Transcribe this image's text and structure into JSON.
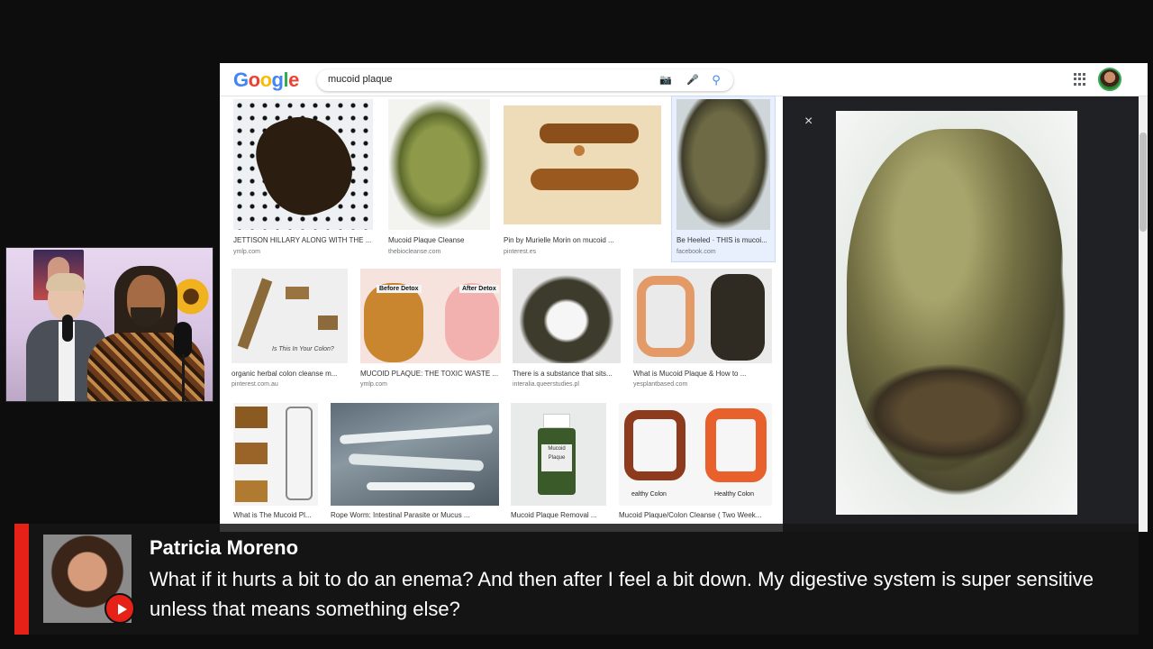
{
  "search": {
    "query": "mucoid plaque"
  },
  "logo": {
    "letters": [
      "G",
      "o",
      "o",
      "g",
      "l",
      "e"
    ]
  },
  "results": [
    {
      "caption": "JETTISON HILLARY ALONG WITH THE ...",
      "source": "ymlp.com"
    },
    {
      "caption": "Mucoid Plaque Cleanse",
      "source": "thebiocleanse.com"
    },
    {
      "caption": "Pin by Murielle Morin on mucoid ...",
      "source": "pinterest.es"
    },
    {
      "caption": "Be Heeled · THIS is mucoi...",
      "source": "facebook.com"
    },
    {
      "caption": "organic herbal colon cleanse m...",
      "source": "pinterest.com.au",
      "img_text": "Is This In Your Colon?"
    },
    {
      "caption": "MUCOID PLAQUE: THE TOXIC WASTE ...",
      "source": "ymlp.com",
      "img_text_a": "Before Detox",
      "img_text_b": "After Detox"
    },
    {
      "caption": "There is a substance that sits...",
      "source": "interalia.queerstudies.pl"
    },
    {
      "caption": "What is Mucoid Plaque & How to ...",
      "source": "yesplantbased.com"
    },
    {
      "caption": "What is The Mucoid Pl...",
      "source": ""
    },
    {
      "caption": "Rope Worm: Intestinal Parasite or Mucus ...",
      "source": ""
    },
    {
      "caption": "Mucoid Plaque Removal ...",
      "source": "",
      "img_text": "Mucoid Plaque"
    },
    {
      "caption": "Mucoid Plaque/Colon Cleanse ( Two Week...",
      "source": "",
      "img_text_a": "ealthy Colon",
      "img_text_b": "Healthy Colon"
    }
  ],
  "chat": {
    "name": "Patricia Moreno",
    "message": "What if it hurts a bit to do an enema? And then after I feel a bit down. My digestive system is super sensitive unless that means something else?"
  },
  "icons": {
    "close": "×",
    "camera": "📷",
    "mic": "🎤",
    "search": "⚲"
  },
  "colors": {
    "accent": "#e62117",
    "viewer_bg": "#202124"
  }
}
